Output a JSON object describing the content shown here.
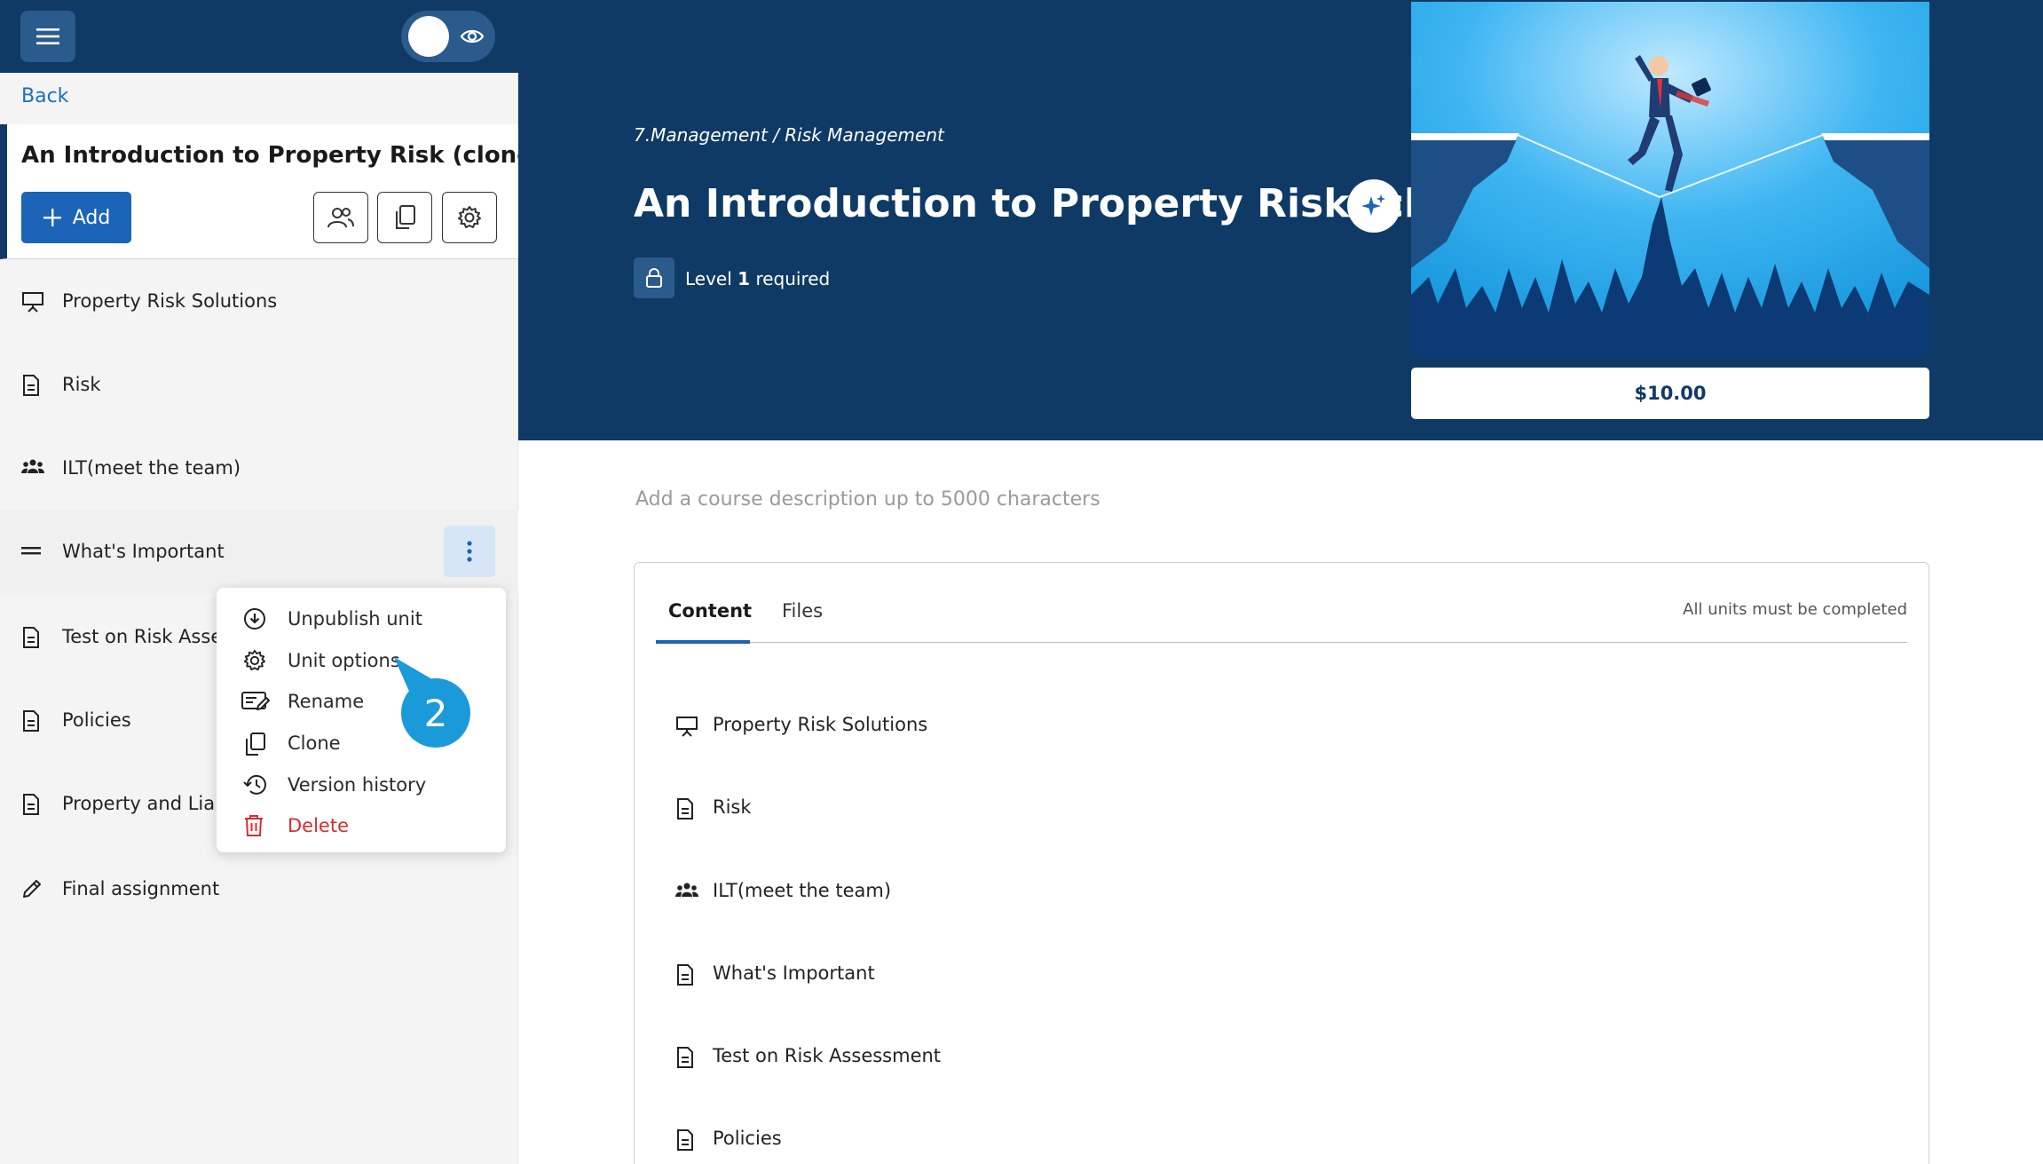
{
  "sidebar": {
    "back_label": "Back",
    "course_title": "An Introduction to Property Risk (clone)",
    "add_label": "Add",
    "units": [
      {
        "label": "Property Risk Solutions",
        "icon": "presentation-icon"
      },
      {
        "label": "Risk",
        "icon": "document-icon"
      },
      {
        "label": "ILT(meet the team)",
        "icon": "group-icon"
      },
      {
        "label": "What's Important",
        "icon": "section-divider-icon"
      },
      {
        "label": "Test on Risk Assess",
        "icon": "document-icon"
      },
      {
        "label": "Policies",
        "icon": "document-icon"
      },
      {
        "label": "Property and Liabi",
        "icon": "document-icon"
      },
      {
        "label": "Final assignment",
        "icon": "pencil-icon"
      }
    ]
  },
  "context_menu": {
    "items": [
      {
        "label": "Unpublish unit",
        "icon": "download-circle-icon"
      },
      {
        "label": "Unit options",
        "icon": "gear-icon"
      },
      {
        "label": "Rename",
        "icon": "rename-icon"
      },
      {
        "label": "Clone",
        "icon": "copy-icon"
      },
      {
        "label": "Version history",
        "icon": "history-icon"
      },
      {
        "label": "Delete",
        "icon": "trash-icon"
      }
    ]
  },
  "step_badge": "2",
  "banner": {
    "breadcrumb": "7.Management / Risk Management",
    "title": "An Introduction to Property Risk (clone)",
    "level_prefix": "Level",
    "level_value": "1",
    "level_suffix": "required",
    "price": "$10.00"
  },
  "main": {
    "description_placeholder": "Add a course description up to 5000 characters",
    "tabs": [
      {
        "label": "Content"
      },
      {
        "label": "Files"
      }
    ],
    "completion_note": "All units must be completed",
    "units": [
      {
        "label": "Property Risk Solutions",
        "icon": "presentation-icon"
      },
      {
        "label": "Risk",
        "icon": "document-icon"
      },
      {
        "label": "ILT(meet the team)",
        "icon": "group-icon"
      },
      {
        "label": "What's Important",
        "icon": "document-icon"
      },
      {
        "label": "Test on Risk Assessment",
        "icon": "document-icon"
      },
      {
        "label": "Policies",
        "icon": "document-icon"
      }
    ]
  },
  "colors": {
    "navy": "#0f3a66",
    "primary_blue": "#1b64b8",
    "badge_blue": "#1a9ad8",
    "danger_red": "#d32f2f"
  }
}
